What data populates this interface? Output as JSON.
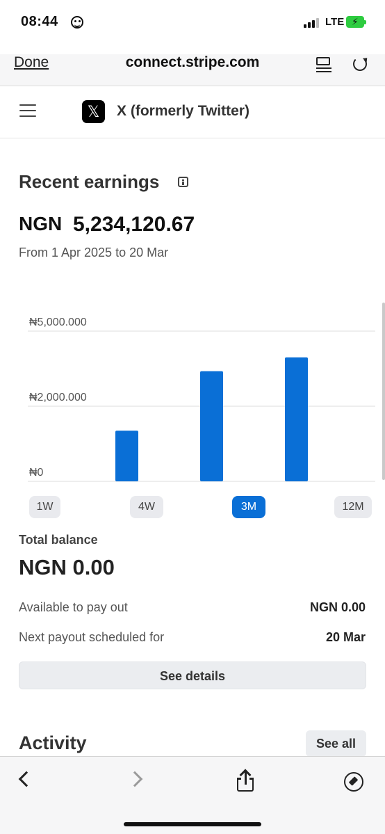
{
  "status_bar": {
    "time": "08:44",
    "network": "LTE"
  },
  "browser": {
    "done_label": "Done",
    "url": "connect.stripe.com"
  },
  "app": {
    "logo_glyph": "𝕏",
    "title": "X (formerly Twitter)"
  },
  "earnings": {
    "title": "Recent earnings",
    "currency": "NGN",
    "amount": "5,234,120.67",
    "range_text": "From 1 Apr 2025 to 20 Mar"
  },
  "chart_data": {
    "type": "bar",
    "title": "",
    "xlabel": "",
    "ylabel": "",
    "y_tick_labels": [
      "₦5,000.000",
      "₦2,000.000",
      "₦0"
    ],
    "y_ticks": [
      5000000,
      2000000,
      0
    ],
    "ylim": [
      0,
      5000000
    ],
    "categories": [
      "",
      "",
      "",
      ""
    ],
    "values": [
      0,
      1350000,
      3400000,
      3950000
    ],
    "bar_color": "#0a6fd6",
    "grid": true
  },
  "ranges": [
    {
      "label": "1W",
      "active": false
    },
    {
      "label": "4W",
      "active": false
    },
    {
      "label": "3M",
      "active": true
    },
    {
      "label": "12M",
      "active": false
    }
  ],
  "balance": {
    "total_label": "Total balance",
    "total_value": "NGN 0.00",
    "available_label": "Available to pay out",
    "available_value": "NGN 0.00",
    "next_payout_label": "Next payout scheduled for",
    "next_payout_value": "20 Mar",
    "details_label": "See details"
  },
  "activity": {
    "title": "Activity",
    "see_all_label": "See all"
  },
  "colors": {
    "accent": "#0a6fd6",
    "battery": "#2ecc40"
  }
}
